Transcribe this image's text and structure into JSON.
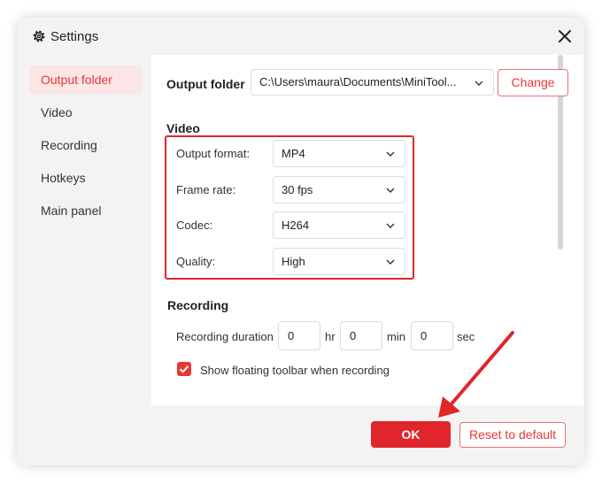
{
  "window": {
    "title": "Settings",
    "title_icon": "gear-icon",
    "close_icon": "close-icon"
  },
  "sidebar": {
    "items": [
      {
        "label": "Output folder",
        "active": true
      },
      {
        "label": "Video",
        "active": false
      },
      {
        "label": "Recording",
        "active": false
      },
      {
        "label": "Hotkeys",
        "active": false
      },
      {
        "label": "Main panel",
        "active": false
      }
    ]
  },
  "output_folder": {
    "label": "Output folder",
    "path": "C:\\Users\\maura\\Documents\\MiniTool...",
    "change_label": "Change"
  },
  "video": {
    "heading": "Video",
    "format_label": "Output format:",
    "format_value": "MP4",
    "framerate_label": "Frame rate:",
    "framerate_value": "30 fps",
    "codec_label": "Codec:",
    "codec_value": "H264",
    "quality_label": "Quality:",
    "quality_value": "High"
  },
  "recording": {
    "heading": "Recording",
    "duration_label": "Recording duration",
    "hours": "0",
    "hours_unit": "hr",
    "minutes": "0",
    "minutes_unit": "min",
    "seconds": "0",
    "seconds_unit": "sec",
    "floating_toolbar_label": "Show floating toolbar when recording",
    "floating_toolbar_checked": true
  },
  "footer": {
    "ok_label": "OK",
    "reset_label": "Reset to default"
  },
  "colors": {
    "accent": "#e0262b",
    "active_bg": "#fbe5e5",
    "panel_bg": "#f3f3f3"
  }
}
